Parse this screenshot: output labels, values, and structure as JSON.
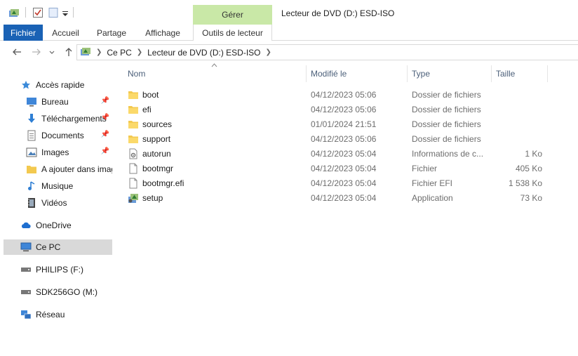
{
  "window": {
    "title": "Lecteur de DVD (D:) ESD-ISO",
    "contextual_group": "Gérer"
  },
  "ribbon": {
    "tabs": [
      "Fichier",
      "Accueil",
      "Partage",
      "Affichage",
      "Outils de lecteur"
    ]
  },
  "address": {
    "crumbs": [
      "Ce PC",
      "Lecteur de DVD (D:) ESD-ISO"
    ]
  },
  "sidebar": {
    "quick_access": "Accès rapide",
    "pinned": [
      {
        "label": "Bureau",
        "icon": "desktop-icon"
      },
      {
        "label": "Téléchargements",
        "icon": "download-icon"
      },
      {
        "label": "Documents",
        "icon": "documents-icon"
      },
      {
        "label": "Images",
        "icon": "images-icon"
      }
    ],
    "recent": [
      {
        "label": "A ajouter dans images",
        "icon": "folder-icon"
      },
      {
        "label": "Musique",
        "icon": "music-icon"
      },
      {
        "label": "Vidéos",
        "icon": "video-icon"
      }
    ],
    "onedrive": "OneDrive",
    "this_pc": "Ce PC",
    "drives": [
      "PHILIPS (F:)",
      "SDK256GO (M:)"
    ],
    "network": "Réseau"
  },
  "columns": {
    "name": "Nom",
    "modified": "Modifié le",
    "type": "Type",
    "size": "Taille"
  },
  "files": [
    {
      "name": "boot",
      "modified": "04/12/2023 05:06",
      "type": "Dossier de fichiers",
      "size": "",
      "icon": "folder-icon"
    },
    {
      "name": "efi",
      "modified": "04/12/2023 05:06",
      "type": "Dossier de fichiers",
      "size": "",
      "icon": "folder-icon"
    },
    {
      "name": "sources",
      "modified": "01/01/2024 21:51",
      "type": "Dossier de fichiers",
      "size": "",
      "icon": "folder-icon"
    },
    {
      "name": "support",
      "modified": "04/12/2023 05:06",
      "type": "Dossier de fichiers",
      "size": "",
      "icon": "folder-icon"
    },
    {
      "name": "autorun",
      "modified": "04/12/2023 05:04",
      "type": "Informations de c...",
      "size": "1 Ko",
      "icon": "settings-file-icon"
    },
    {
      "name": "bootmgr",
      "modified": "04/12/2023 05:04",
      "type": "Fichier",
      "size": "405 Ko",
      "icon": "file-icon"
    },
    {
      "name": "bootmgr.efi",
      "modified": "04/12/2023 05:04",
      "type": "Fichier EFI",
      "size": "1 538 Ko",
      "icon": "file-icon"
    },
    {
      "name": "setup",
      "modified": "04/12/2023 05:04",
      "type": "Application",
      "size": "73 Ko",
      "icon": "setup-app-icon"
    }
  ],
  "colors": {
    "accent": "#1a62b5",
    "contextual_tab": "#c9e8a7",
    "folder": "#f3c94f",
    "selected": "#d9d9d9"
  }
}
